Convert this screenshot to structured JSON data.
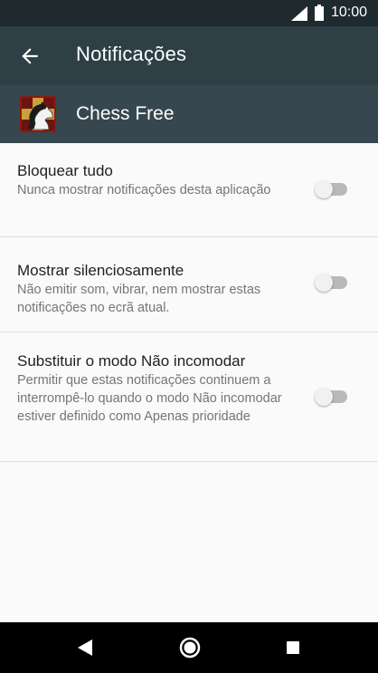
{
  "status_bar": {
    "time": "10:00",
    "icons": [
      "signal-icon",
      "battery-icon"
    ]
  },
  "app_bar": {
    "back_icon": "arrow-back-icon",
    "title": "Notificações"
  },
  "app_header": {
    "icon": "chess-app-icon",
    "name": "Chess Free"
  },
  "settings": [
    {
      "title": "Bloquear tudo",
      "summary": "Nunca mostrar notificações desta aplicação",
      "enabled": false
    },
    {
      "title": "Mostrar silenciosamente",
      "summary": "Não emitir som, vibrar, nem mostrar estas notificações no ecrã atual.",
      "enabled": false
    },
    {
      "title": "Substituir o modo Não incomodar",
      "summary": "Permitir que estas notificações continuem a interrompê-lo quando o modo Não incomodar estiver definido como Apenas prioridade",
      "enabled": false
    }
  ],
  "nav_bar": {
    "icons": [
      "nav-back-icon",
      "nav-home-icon",
      "nav-recents-icon"
    ]
  },
  "colors": {
    "status_bar": "#1f2a2f",
    "app_bar": "#2f3f46",
    "app_header": "#37474f",
    "background": "#fafafa",
    "toggle_track_off": "#b9b9b9",
    "toggle_thumb_off": "#f1f1f1"
  }
}
